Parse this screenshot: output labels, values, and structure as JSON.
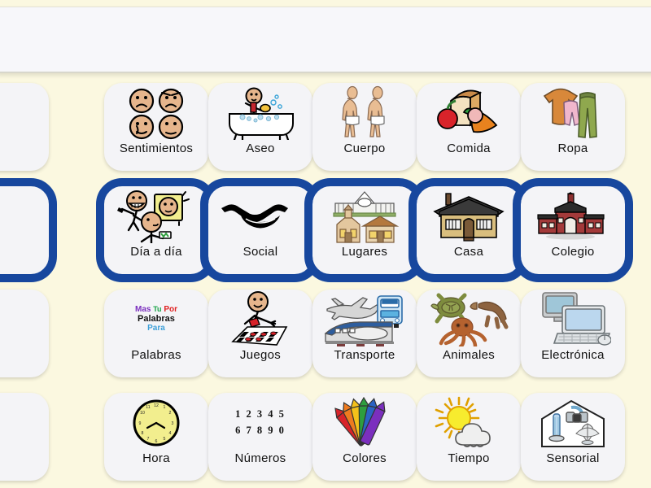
{
  "app": {
    "background_color": "#FBF8E0",
    "selection_color": "#17479E",
    "card_color": "#F4F4F7"
  },
  "sentence_bar": {
    "text": "",
    "background_color": "#F7F7FA"
  },
  "grid": {
    "columns": 7,
    "rows": 4,
    "cells": [
      {
        "label": "",
        "icon": "blank",
        "selected": false,
        "partial": true,
        "color": "#F4F4F7"
      },
      {
        "label": "Sentimientos",
        "icon": "feelings-faces-icon",
        "selected": false,
        "partial": false,
        "color": "#F4F4F7"
      },
      {
        "label": "Aseo",
        "icon": "bathtub-icon",
        "selected": false,
        "partial": false,
        "color": "#F4F4F7"
      },
      {
        "label": "Cuerpo",
        "icon": "two-bodies-icon",
        "selected": false,
        "partial": false,
        "color": "#F4F4F7"
      },
      {
        "label": "Comida",
        "icon": "food-bread-carrot-apple-icon",
        "selected": false,
        "partial": false,
        "color": "#F4F4F7"
      },
      {
        "label": "Ropa",
        "icon": "clothing-shirt-pants-icon",
        "selected": false,
        "partial": false,
        "color": "#F4F4F7"
      },
      {
        "label": "",
        "icon": "blank",
        "selected": false,
        "partial": true,
        "color": "#44B8A3"
      },
      {
        "label": "",
        "icon": "blank",
        "selected": true,
        "partial": true,
        "color": "#F4F4F7"
      },
      {
        "label": "Día a día",
        "icon": "daily-life-people-icon",
        "selected": true,
        "partial": false,
        "color": "#F4F4F7"
      },
      {
        "label": "Social",
        "icon": "handshake-icon",
        "selected": true,
        "partial": false,
        "color": "#F4F4F7"
      },
      {
        "label": "Lugares",
        "icon": "places-buildings-icon",
        "selected": true,
        "partial": false,
        "color": "#F4F4F7"
      },
      {
        "label": "Casa",
        "icon": "house-icon",
        "selected": true,
        "partial": false,
        "color": "#F4F4F7"
      },
      {
        "label": "Colegio",
        "icon": "school-building-icon",
        "selected": true,
        "partial": false,
        "color": "#F4F4F7"
      },
      {
        "label": "",
        "icon": "blank",
        "selected": true,
        "partial": true,
        "color": "#E87A78"
      },
      {
        "label": "",
        "icon": "blank",
        "selected": false,
        "partial": true,
        "color": "#F4F4F7"
      },
      {
        "label": "Palabras",
        "icon": "words-text-icon",
        "selected": false,
        "partial": false,
        "color": "#F4F4F7"
      },
      {
        "label": "Juegos",
        "icon": "games-boardgame-icon",
        "selected": false,
        "partial": false,
        "color": "#F4F4F7"
      },
      {
        "label": "Transporte",
        "icon": "transport-plane-bus-train-icon",
        "selected": false,
        "partial": false,
        "color": "#F4F4F7"
      },
      {
        "label": "Animales",
        "icon": "animals-turtle-octopus-icon",
        "selected": false,
        "partial": false,
        "color": "#F4F4F7"
      },
      {
        "label": "Electrónica",
        "icon": "electronics-computer-icon",
        "selected": false,
        "partial": false,
        "color": "#F4F4F7"
      },
      {
        "label": "",
        "icon": "blank",
        "selected": false,
        "partial": true,
        "color": "#E87A78"
      },
      {
        "label": "",
        "icon": "blank",
        "selected": false,
        "partial": true,
        "color": "#F4F4F7"
      },
      {
        "label": "Hora",
        "icon": "clock-icon",
        "selected": false,
        "partial": false,
        "color": "#F4F4F7"
      },
      {
        "label": "Números",
        "icon": "numbers-icon",
        "selected": false,
        "partial": false,
        "color": "#F4F4F7"
      },
      {
        "label": "Colores",
        "icon": "colors-crayons-icon",
        "selected": false,
        "partial": false,
        "color": "#F4F4F7"
      },
      {
        "label": "Tiempo",
        "icon": "weather-sun-cloud-icon",
        "selected": false,
        "partial": false,
        "color": "#F4F4F7"
      },
      {
        "label": "Sensorial",
        "icon": "sensory-room-icon",
        "selected": false,
        "partial": false,
        "color": "#F4F4F7"
      },
      {
        "label": "",
        "icon": "blank",
        "selected": false,
        "partial": true,
        "color": "#F4F4F7"
      }
    ]
  },
  "icon_text": {
    "numbers_row1": "1 2 3 4 5",
    "numbers_row2": "6 7 8 9 0",
    "words_mas": "Mas",
    "words_tu": "Tu",
    "words_por": "Por",
    "words_palabras": "Palabras",
    "words_para": "Para"
  }
}
